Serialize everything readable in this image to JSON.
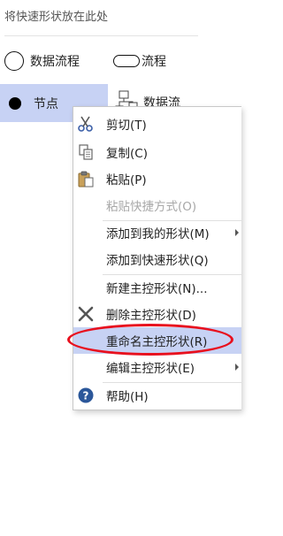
{
  "quick_shapes": {
    "hint": "将快速形状放在此处",
    "shapes": [
      {
        "label": "数据流程",
        "icon": "circle-outline-icon"
      },
      {
        "label": "流程",
        "icon": "rounded-rectangle-icon"
      },
      {
        "label": "节点",
        "icon": "filled-circle-icon",
        "selected": true
      },
      {
        "label": "数据流",
        "icon": "data-flow-icon"
      }
    ]
  },
  "context_menu": {
    "items": [
      {
        "label": "剪切(T)",
        "icon": "scissors-icon",
        "enabled": true
      },
      {
        "label": "复制(C)",
        "icon": "copy-icon",
        "enabled": true
      },
      {
        "label": "粘贴(P)",
        "icon": "clipboard-paste-icon",
        "enabled": true
      },
      {
        "label": "粘贴快捷方式(O)",
        "icon": "",
        "enabled": false
      },
      {
        "label": "添加到我的形状(M)",
        "icon": "",
        "enabled": true,
        "submenu": true
      },
      {
        "label": "添加到快速形状(Q)",
        "icon": "",
        "enabled": true
      },
      {
        "label": "新建主控形状(N)...",
        "icon": "",
        "enabled": true
      },
      {
        "label": "删除主控形状(D)",
        "icon": "delete-x-icon",
        "enabled": true
      },
      {
        "label": "重命名主控形状(R)",
        "icon": "",
        "enabled": true,
        "highlighted": true
      },
      {
        "label": "编辑主控形状(E)",
        "icon": "",
        "enabled": true,
        "submenu": true
      },
      {
        "label": "帮助(H)",
        "icon": "help-icon",
        "enabled": true
      }
    ]
  },
  "colors": {
    "selection": "#c7d2f4",
    "annotation_ellipse": "#e8101e",
    "disabled_text": "#a8a8a8",
    "help_icon": "#2b579a"
  }
}
